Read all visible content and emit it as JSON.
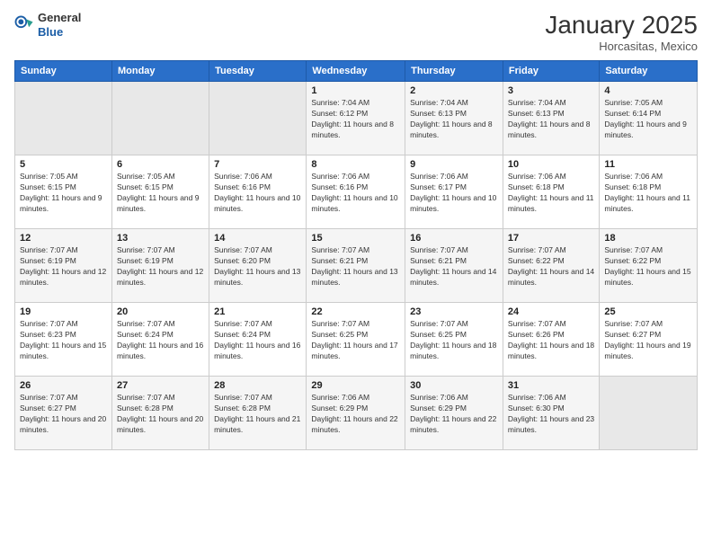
{
  "header": {
    "logo": {
      "general": "General",
      "blue": "Blue"
    },
    "title": "January 2025",
    "location": "Horcasitas, Mexico"
  },
  "days_header": [
    "Sunday",
    "Monday",
    "Tuesday",
    "Wednesday",
    "Thursday",
    "Friday",
    "Saturday"
  ],
  "weeks": [
    [
      {
        "num": "",
        "empty": true
      },
      {
        "num": "",
        "empty": true
      },
      {
        "num": "",
        "empty": true
      },
      {
        "num": "1",
        "sunrise": "7:04 AM",
        "sunset": "6:12 PM",
        "daylight": "11 hours and 8 minutes."
      },
      {
        "num": "2",
        "sunrise": "7:04 AM",
        "sunset": "6:13 PM",
        "daylight": "11 hours and 8 minutes."
      },
      {
        "num": "3",
        "sunrise": "7:04 AM",
        "sunset": "6:13 PM",
        "daylight": "11 hours and 8 minutes."
      },
      {
        "num": "4",
        "sunrise": "7:05 AM",
        "sunset": "6:14 PM",
        "daylight": "11 hours and 9 minutes."
      }
    ],
    [
      {
        "num": "5",
        "sunrise": "7:05 AM",
        "sunset": "6:15 PM",
        "daylight": "11 hours and 9 minutes."
      },
      {
        "num": "6",
        "sunrise": "7:05 AM",
        "sunset": "6:15 PM",
        "daylight": "11 hours and 9 minutes."
      },
      {
        "num": "7",
        "sunrise": "7:06 AM",
        "sunset": "6:16 PM",
        "daylight": "11 hours and 10 minutes."
      },
      {
        "num": "8",
        "sunrise": "7:06 AM",
        "sunset": "6:16 PM",
        "daylight": "11 hours and 10 minutes."
      },
      {
        "num": "9",
        "sunrise": "7:06 AM",
        "sunset": "6:17 PM",
        "daylight": "11 hours and 10 minutes."
      },
      {
        "num": "10",
        "sunrise": "7:06 AM",
        "sunset": "6:18 PM",
        "daylight": "11 hours and 11 minutes."
      },
      {
        "num": "11",
        "sunrise": "7:06 AM",
        "sunset": "6:18 PM",
        "daylight": "11 hours and 11 minutes."
      }
    ],
    [
      {
        "num": "12",
        "sunrise": "7:07 AM",
        "sunset": "6:19 PM",
        "daylight": "11 hours and 12 minutes."
      },
      {
        "num": "13",
        "sunrise": "7:07 AM",
        "sunset": "6:19 PM",
        "daylight": "11 hours and 12 minutes."
      },
      {
        "num": "14",
        "sunrise": "7:07 AM",
        "sunset": "6:20 PM",
        "daylight": "11 hours and 13 minutes."
      },
      {
        "num": "15",
        "sunrise": "7:07 AM",
        "sunset": "6:21 PM",
        "daylight": "11 hours and 13 minutes."
      },
      {
        "num": "16",
        "sunrise": "7:07 AM",
        "sunset": "6:21 PM",
        "daylight": "11 hours and 14 minutes."
      },
      {
        "num": "17",
        "sunrise": "7:07 AM",
        "sunset": "6:22 PM",
        "daylight": "11 hours and 14 minutes."
      },
      {
        "num": "18",
        "sunrise": "7:07 AM",
        "sunset": "6:22 PM",
        "daylight": "11 hours and 15 minutes."
      }
    ],
    [
      {
        "num": "19",
        "sunrise": "7:07 AM",
        "sunset": "6:23 PM",
        "daylight": "11 hours and 15 minutes."
      },
      {
        "num": "20",
        "sunrise": "7:07 AM",
        "sunset": "6:24 PM",
        "daylight": "11 hours and 16 minutes."
      },
      {
        "num": "21",
        "sunrise": "7:07 AM",
        "sunset": "6:24 PM",
        "daylight": "11 hours and 16 minutes."
      },
      {
        "num": "22",
        "sunrise": "7:07 AM",
        "sunset": "6:25 PM",
        "daylight": "11 hours and 17 minutes."
      },
      {
        "num": "23",
        "sunrise": "7:07 AM",
        "sunset": "6:25 PM",
        "daylight": "11 hours and 18 minutes."
      },
      {
        "num": "24",
        "sunrise": "7:07 AM",
        "sunset": "6:26 PM",
        "daylight": "11 hours and 18 minutes."
      },
      {
        "num": "25",
        "sunrise": "7:07 AM",
        "sunset": "6:27 PM",
        "daylight": "11 hours and 19 minutes."
      }
    ],
    [
      {
        "num": "26",
        "sunrise": "7:07 AM",
        "sunset": "6:27 PM",
        "daylight": "11 hours and 20 minutes."
      },
      {
        "num": "27",
        "sunrise": "7:07 AM",
        "sunset": "6:28 PM",
        "daylight": "11 hours and 20 minutes."
      },
      {
        "num": "28",
        "sunrise": "7:07 AM",
        "sunset": "6:28 PM",
        "daylight": "11 hours and 21 minutes."
      },
      {
        "num": "29",
        "sunrise": "7:06 AM",
        "sunset": "6:29 PM",
        "daylight": "11 hours and 22 minutes."
      },
      {
        "num": "30",
        "sunrise": "7:06 AM",
        "sunset": "6:29 PM",
        "daylight": "11 hours and 22 minutes."
      },
      {
        "num": "31",
        "sunrise": "7:06 AM",
        "sunset": "6:30 PM",
        "daylight": "11 hours and 23 minutes."
      },
      {
        "num": "",
        "empty": true
      }
    ]
  ],
  "labels": {
    "sunrise_prefix": "Sunrise: ",
    "sunset_prefix": "Sunset: ",
    "daylight_prefix": "Daylight: "
  }
}
